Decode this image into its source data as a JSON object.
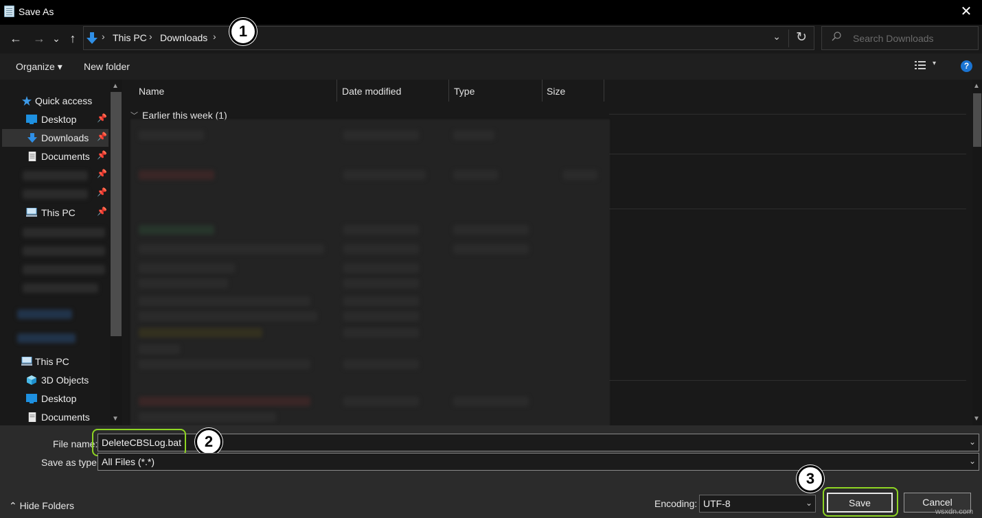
{
  "window": {
    "title": "Save As",
    "close_glyph": "✕"
  },
  "nav": {
    "back_glyph": "←",
    "forward_glyph": "→",
    "recent_glyph": "⌄",
    "up_glyph": "↑"
  },
  "address": {
    "segments": [
      "This PC",
      "Downloads"
    ],
    "separator": "›",
    "dropdown_glyph": "⌄",
    "refresh_glyph": "↻"
  },
  "search": {
    "placeholder": "Search Downloads"
  },
  "toolbar": {
    "organize_label": "Organize ▾",
    "new_folder_label": "New folder",
    "view_dropdown_glyph": "▾",
    "help_label": "?"
  },
  "sidebar": {
    "items": [
      {
        "label": "Quick access",
        "icon": "star-icon"
      },
      {
        "label": "Desktop",
        "icon": "desktop-icon"
      },
      {
        "label": "Downloads",
        "icon": "download-icon"
      },
      {
        "label": "Documents",
        "icon": "documents-icon"
      },
      {
        "label": "This PC",
        "icon": "computer-icon"
      },
      {
        "label": "This PC",
        "icon": "computer-icon"
      },
      {
        "label": "3D Objects",
        "icon": "cube-icon"
      },
      {
        "label": "Desktop",
        "icon": "desktop-icon"
      },
      {
        "label": "Documents",
        "icon": "documents-icon"
      }
    ],
    "pin_glyph": "📌"
  },
  "filelist": {
    "columns": [
      "Name",
      "Date modified",
      "Type",
      "Size"
    ],
    "group_label": "Earlier this week (1)",
    "group_chevron": "﹀"
  },
  "form": {
    "file_name_label": "File name:",
    "file_name_value": "DeleteCBSLog.bat",
    "save_type_label": "Save as type:",
    "save_type_value": "All Files  (*.*)",
    "encoding_label": "Encoding:",
    "encoding_value": "UTF-8",
    "dropdown_glyph": "⌄"
  },
  "footer": {
    "hide_folders_label": "Hide Folders",
    "hide_folders_glyph": "⌃",
    "save_label": "Save",
    "cancel_label": "Cancel"
  },
  "markers": [
    "1",
    "2",
    "3"
  ],
  "watermark": "wsxdn.com",
  "colors": {
    "accent_blue": "#1a74d2",
    "highlight_green": "#8fd623",
    "background": "#191919"
  }
}
